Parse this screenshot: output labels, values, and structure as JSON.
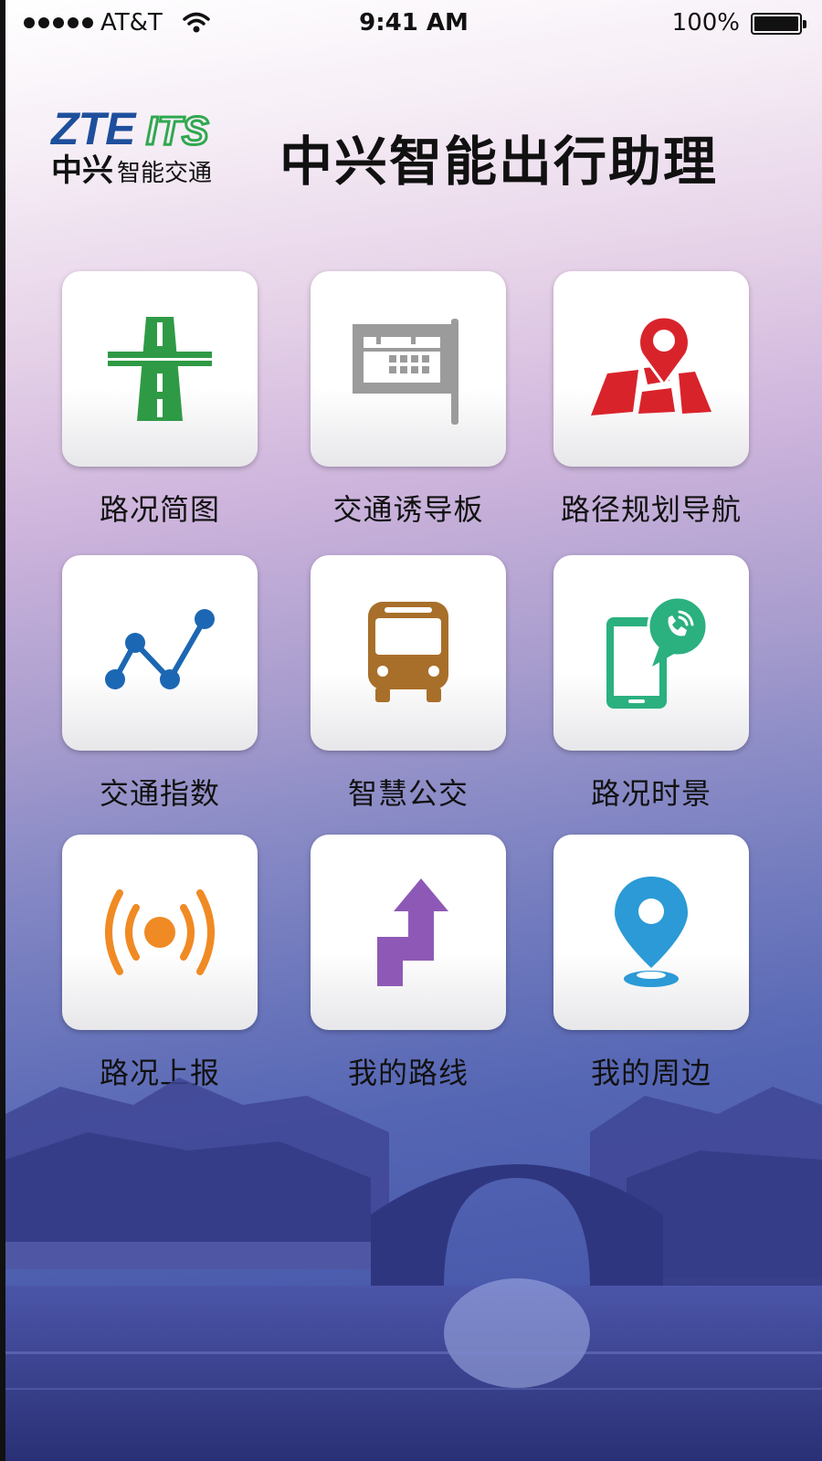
{
  "status_bar": {
    "carrier": "AT&T",
    "time": "9:41 AM",
    "battery": "100%",
    "battery_level": 1.0
  },
  "header": {
    "logo_brand": "ZTE",
    "logo_product": "ITS",
    "logo_sub_bold": "中兴",
    "logo_sub": "智能交通",
    "title": "中兴智能出行助理"
  },
  "tiles": [
    {
      "label": "路况简图",
      "icon": "highway-icon",
      "color": "#2f9a45"
    },
    {
      "label": "交通诱导板",
      "icon": "guidance-board-icon",
      "color": "#9b9b9b"
    },
    {
      "label": "路径规划导航",
      "icon": "map-pin-icon",
      "color": "#d9232b"
    },
    {
      "label": "交通指数",
      "icon": "line-chart-icon",
      "color": "#1c67b3"
    },
    {
      "label": "智慧公交",
      "icon": "bus-icon",
      "color": "#a86f2a"
    },
    {
      "label": "路况时景",
      "icon": "phone-call-icon",
      "color": "#2bb07f"
    },
    {
      "label": "路况上报",
      "icon": "broadcast-icon",
      "color": "#f08a24"
    },
    {
      "label": "我的路线",
      "icon": "route-arrow-icon",
      "color": "#8e59b6"
    },
    {
      "label": "我的周边",
      "icon": "location-icon",
      "color": "#2b9ad6"
    }
  ]
}
